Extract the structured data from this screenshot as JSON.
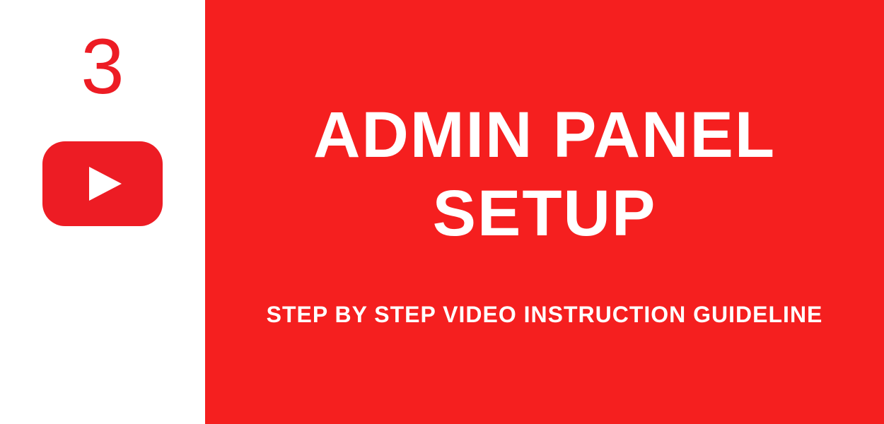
{
  "left": {
    "step_number": "3"
  },
  "right": {
    "title": "ADMIN PANEL\nSETUP",
    "subtitle": "STEP BY STEP VIDEO INSTRUCTION GUIDELINE"
  },
  "colors": {
    "accent_red": "#f51f1f",
    "number_red": "#ed1c24",
    "white": "#ffffff"
  }
}
